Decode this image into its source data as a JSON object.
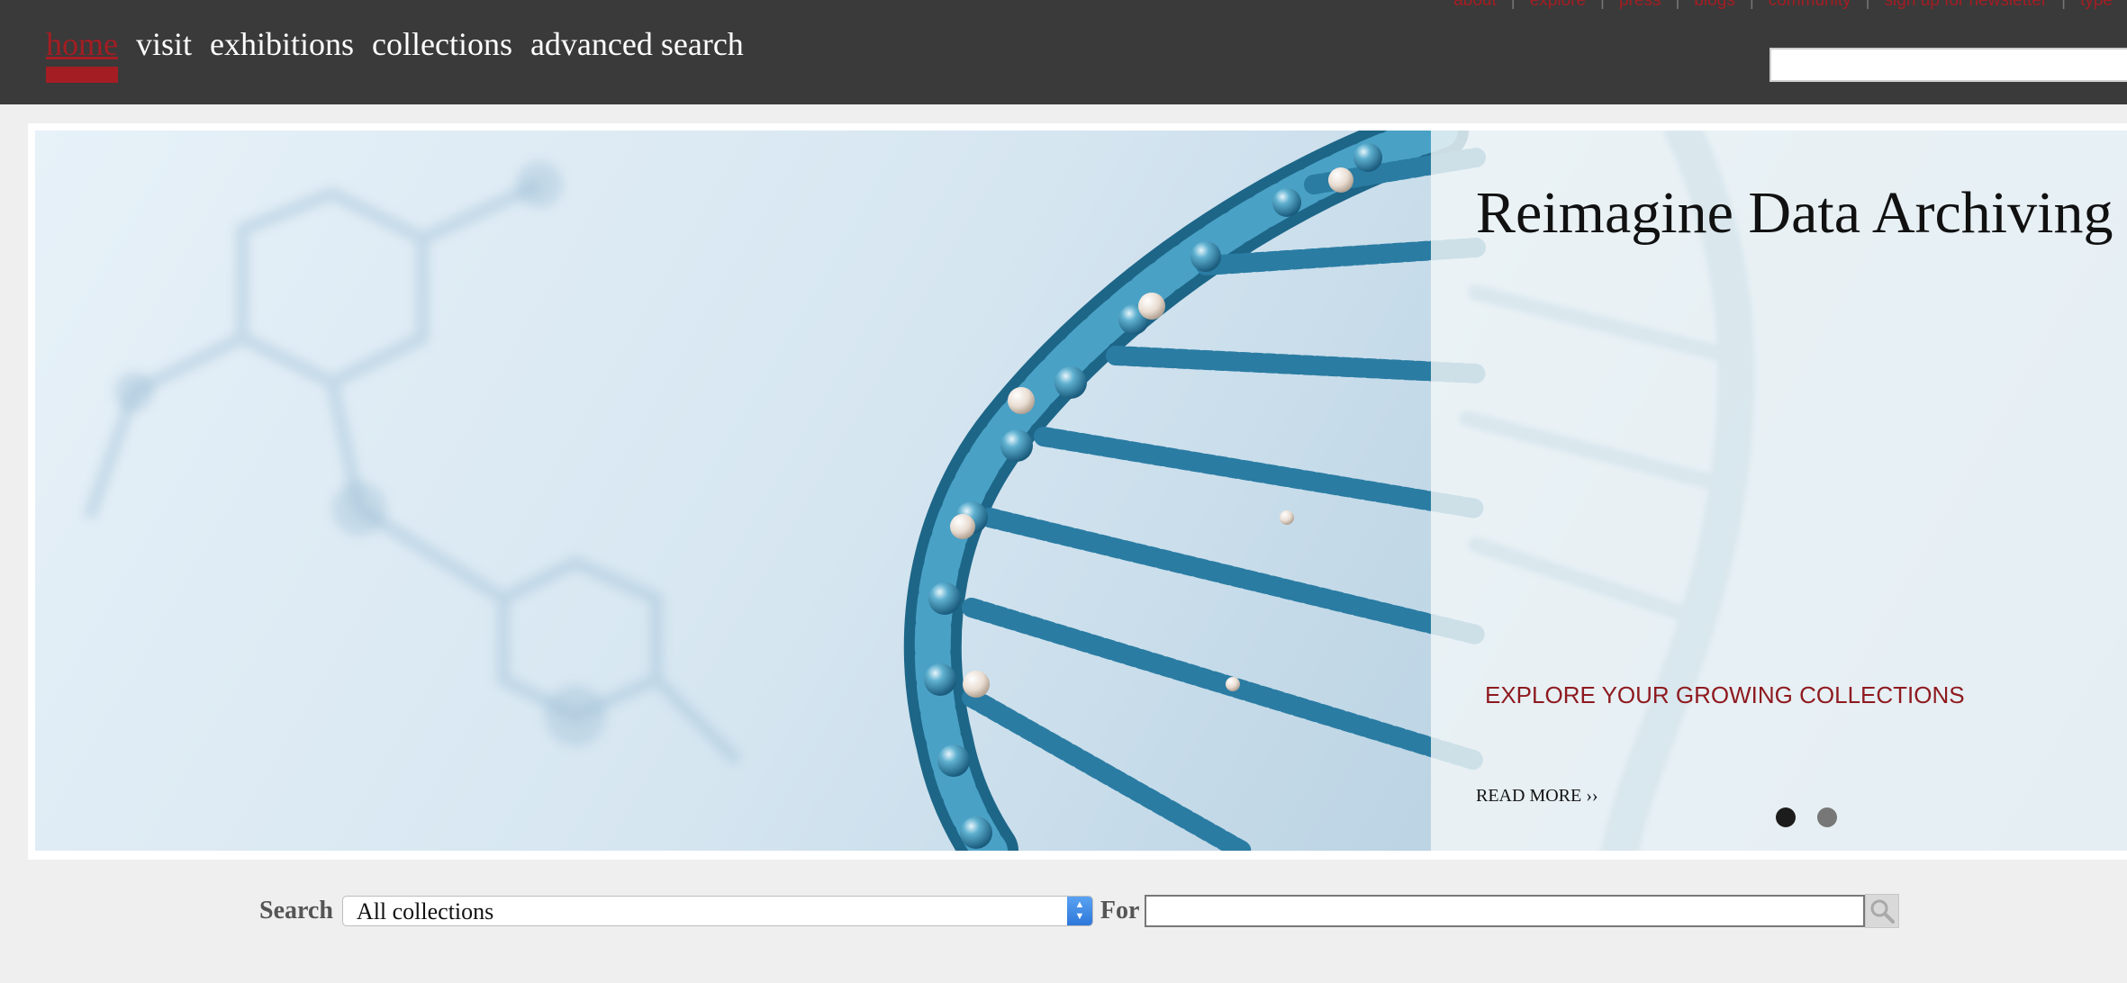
{
  "utility_nav": {
    "links": [
      "about",
      "explore",
      "press",
      "blogs",
      "community",
      "sign up for newsletter",
      "type"
    ]
  },
  "main_nav": {
    "items": [
      {
        "label": "home",
        "active": true
      },
      {
        "label": "visit",
        "active": false
      },
      {
        "label": "exhibitions",
        "active": false
      },
      {
        "label": "collections",
        "active": false
      },
      {
        "label": "advanced search",
        "active": false
      }
    ]
  },
  "header_search": {
    "value": ""
  },
  "hero": {
    "title": "Reimagine Data Archiving",
    "subtitle": "EXPLORE YOUR GROWING COLLECTIONS",
    "read_more": "READ MORE ››",
    "slide_count": 2,
    "active_slide": 1
  },
  "search_bar": {
    "search_label": "Search",
    "collection_selected": "All collections",
    "for_label": "For",
    "query_value": ""
  },
  "colors": {
    "topbar": "#3a3a3a",
    "accent_red": "#a41d23",
    "page_bg": "#efefef",
    "dna_blue": "#2f7fa3"
  },
  "icons": [
    "search-icon",
    "select-arrows-icon"
  ]
}
